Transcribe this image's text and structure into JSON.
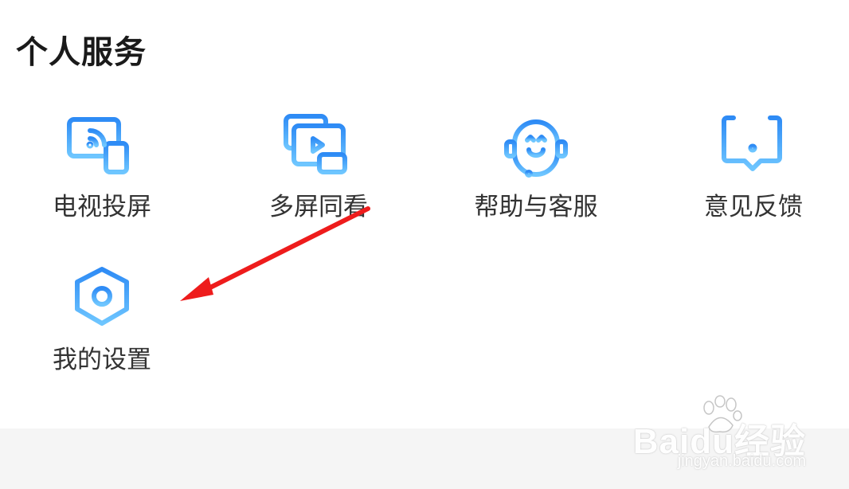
{
  "section": {
    "title": "个人服务"
  },
  "services": [
    {
      "label": "电视投屏",
      "icon": "tv-cast-icon"
    },
    {
      "label": "多屏同看",
      "icon": "multi-screen-icon"
    },
    {
      "label": "帮助与客服",
      "icon": "customer-service-icon"
    },
    {
      "label": "意见反馈",
      "icon": "feedback-icon"
    },
    {
      "label": "我的设置",
      "icon": "settings-icon"
    }
  ],
  "colors": {
    "icon_gradient_top": "#2e8bf5",
    "icon_gradient_bottom": "#6ec6ff",
    "arrow": "#ee1c1c"
  },
  "watermark": {
    "logo": "Baidu经验",
    "url": "jingyan.baidu.com"
  }
}
